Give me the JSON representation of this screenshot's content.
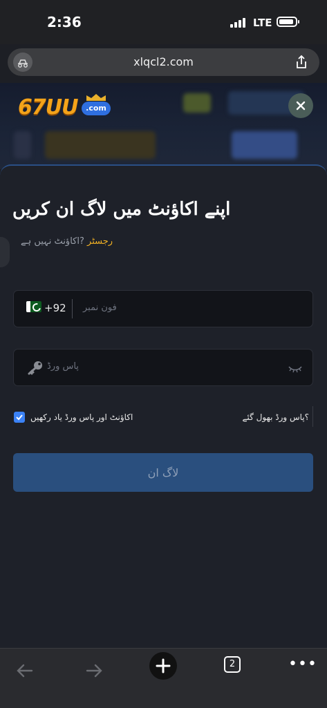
{
  "status_bar": {
    "time": "2:36",
    "network": "LTE"
  },
  "browser": {
    "url": "xlqcl2.com",
    "tab_count": "2"
  },
  "brand": {
    "logo_text": "67UU",
    "logo_suffix": ".com"
  },
  "login": {
    "title": "اپنے اکاؤنٹ میں لاگ ان کریں",
    "no_account": "?اکاؤنٹ نہیں ہے",
    "register_link": "رجسٹر",
    "country_code": "+92",
    "phone_placeholder": "فون نمبر",
    "password_placeholder": "پاس ورڈ",
    "remember_label": "اکاؤنٹ اور پاس ورڈ یاد رکھیں",
    "remember_checked": true,
    "forgot_link": "؟پاس ورڈ بھول گئے",
    "login_button": "لاگ ان"
  },
  "colors": {
    "accent": "#3b82f6",
    "register": "#f0b024",
    "button": "#2a4f7e",
    "sheet": "#1e2129"
  },
  "icons": [
    "signal-icon",
    "battery-icon",
    "tracker-icon",
    "share-icon",
    "close-icon",
    "pakistan-flag-icon",
    "key-icon",
    "eye-closed-icon",
    "checkbox-check-icon",
    "back-arrow-icon",
    "forward-arrow-icon",
    "plus-icon",
    "tabs-icon",
    "more-icon"
  ]
}
